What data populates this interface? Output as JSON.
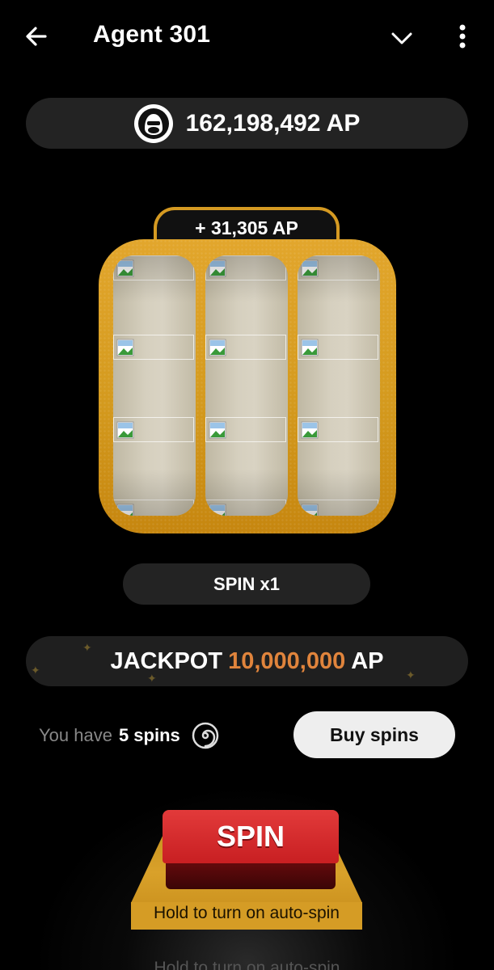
{
  "header": {
    "title": "Agent 301",
    "back_icon": "arrow-left-icon",
    "collapse_icon": "chevron-down-icon",
    "more_icon": "more-vertical-icon"
  },
  "balance": {
    "text": "162,198,492 AP",
    "avatar_icon": "gorilla-avatar-icon"
  },
  "slot": {
    "win_text": "+ 31,305 AP",
    "symbol_icon": "broken-image-icon",
    "frame_color": "#d59a22"
  },
  "multiplier": {
    "label": "SPIN x1"
  },
  "jackpot": {
    "label": "JACKPOT",
    "amount": "10,000,000",
    "unit": "AP",
    "amount_color": "#e0843c"
  },
  "spins": {
    "prefix": "You have",
    "count": "5 spins",
    "spiral_icon": "spiral-icon",
    "buy_label": "Buy spins"
  },
  "spin_button": {
    "label": "SPIN",
    "hint": "Hold to turn on auto-spin",
    "color": "#c81f22"
  },
  "footer_ghost": "Hold to turn on auto-spin"
}
